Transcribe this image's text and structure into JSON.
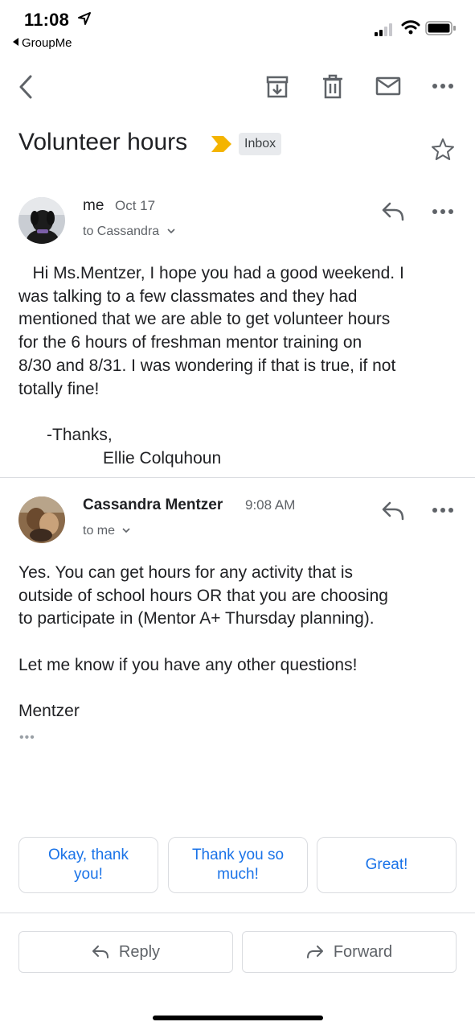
{
  "status_bar": {
    "time": "11:08",
    "back_app": "GroupMe"
  },
  "toolbar": {
    "icons": [
      "back-arrow-icon",
      "archive-icon",
      "trash-icon",
      "mail-icon",
      "more-icon"
    ]
  },
  "subject": {
    "title": "Volunteer hours",
    "label": "Inbox"
  },
  "messages": [
    {
      "sender": "me",
      "date": "Oct 17",
      "to": "to Cassandra",
      "body": "   Hi Ms.Mentzer, I hope you had a good weekend. I\nwas talking to a few classmates and they had\nmentioned that we are able to get volunteer hours\nfor the 6 hours of freshman mentor training on\n8/30 and 8/31. I was wondering if that is true, if not\ntotally fine!\n\n      -Thanks,\n                  Ellie Colquhoun"
    },
    {
      "sender": "Cassandra Mentzer",
      "date": "9:08 AM",
      "to": "to me",
      "body": "Yes. You can get hours for any activity that is\noutside of school hours OR that you are choosing\nto participate in (Mentor A+ Thursday planning).\n\nLet me know if you have any other questions!\n\nMentzer",
      "more": "•••"
    }
  ],
  "smart_replies": [
    "Okay, thank you!",
    "Thank you so much!",
    "Great!"
  ],
  "actions": {
    "reply": "Reply",
    "forward": "Forward"
  },
  "colors": {
    "accent": "#1a73e8",
    "important_marker": "#f4b400",
    "text": "#202124",
    "secondary": "#5f6368"
  }
}
